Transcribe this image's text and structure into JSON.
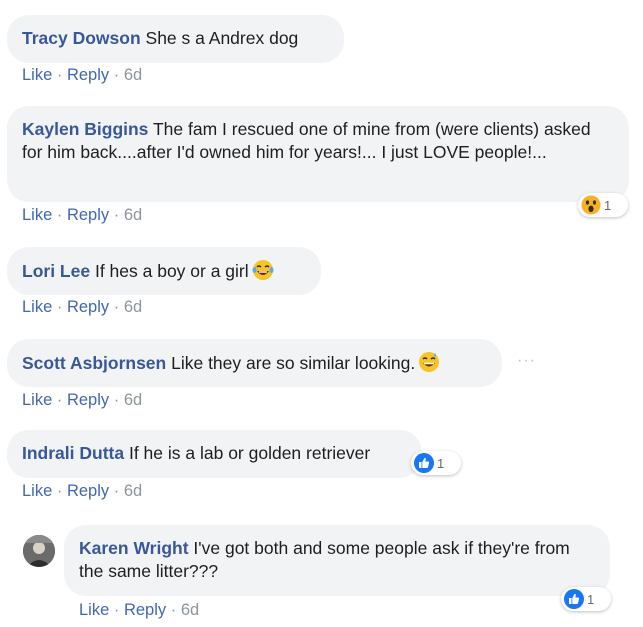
{
  "comments": [
    {
      "author": "Tracy Dowson",
      "text": "She s a Andrex dog",
      "like": "Like",
      "reply": "Reply",
      "time": "6d"
    },
    {
      "author": "Kaylen Biggins",
      "text": "The fam I rescued one of mine from (were clients) asked for him back....after I'd owned him for years!... I just LOVE people!...",
      "like": "Like",
      "reply": "Reply",
      "time": "6d",
      "reaction": {
        "icon": "wow-emoji-icon",
        "count": "1"
      }
    },
    {
      "author": "Lori Lee",
      "text": "If hes a boy or a girl",
      "emoji": "laughing-crying-emoji-icon",
      "like": "Like",
      "reply": "Reply",
      "time": "6d"
    },
    {
      "author": "Scott Asbjornsen",
      "text": "Like they are so similar looking.",
      "emoji": "grinning-sweat-emoji-icon",
      "like": "Like",
      "reply": "Reply",
      "time": "6d",
      "more": "···"
    },
    {
      "author": "Indrali Dutta",
      "text": "If he is a lab or golden retriever",
      "like": "Like",
      "reply": "Reply",
      "time": "6d",
      "reaction": {
        "icon": "like-thumb-icon",
        "count": "1"
      }
    },
    {
      "author": "Karen Wright",
      "text": "I've got both and some people ask if they're from the same litter???",
      "like": "Like",
      "reply": "Reply",
      "time": "6d",
      "reaction": {
        "icon": "like-thumb-icon",
        "count": "1"
      }
    }
  ],
  "colors": {
    "bubble": "#f2f3f5",
    "author": "#385898",
    "link": "#4267b2",
    "meta": "#8d949e",
    "like_blue": "#1877f2"
  }
}
